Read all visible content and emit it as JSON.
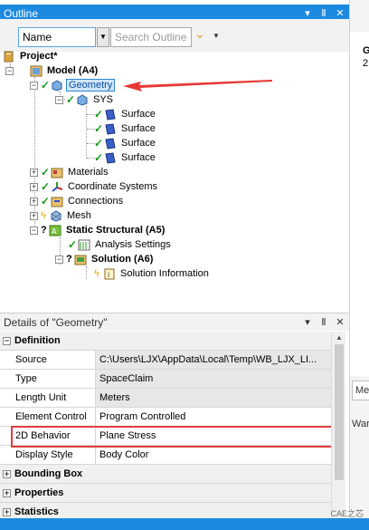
{
  "outline": {
    "title": "Outline",
    "controls": [
      "▾",
      "Ⅱ",
      "✕"
    ],
    "name_select": "Name",
    "search_placeholder": "Search Outline",
    "tree": {
      "project": "Project*",
      "model": "Model (A4)",
      "geometry": "Geometry",
      "sys": "SYS",
      "surfaces": [
        "Surface",
        "Surface",
        "Surface",
        "Surface"
      ],
      "materials": "Materials",
      "coordinate_systems": "Coordinate Systems",
      "connections": "Connections",
      "mesh": "Mesh",
      "static_structural": "Static Structural (A5)",
      "analysis_settings": "Analysis Settings",
      "solution": "Solution (A6)",
      "solution_information": "Solution Information"
    }
  },
  "details": {
    "title": "Details of \"Geometry\"",
    "controls": [
      "▾",
      "Ⅱ",
      "✕"
    ],
    "sections": {
      "definition": "Definition",
      "bounding_box": "Bounding Box",
      "properties": "Properties",
      "statistics": "Statistics"
    },
    "rows": [
      {
        "key": "Source",
        "value": "C:\\Users\\LJX\\AppData\\Local\\Temp\\WB_LJX_LI..."
      },
      {
        "key": "Type",
        "value": "SpaceClaim"
      },
      {
        "key": "Length Unit",
        "value": "Meters"
      },
      {
        "key": "Element Control",
        "value": "Program Controlled"
      },
      {
        "key": "2D Behavior",
        "value": "Plane Stress"
      },
      {
        "key": "Display Style",
        "value": "Body Color"
      }
    ]
  },
  "right_panel": {
    "letter_g": "G",
    "digit_2": "2",
    "tab_me": "Me",
    "war": "War"
  },
  "watermark": "CAE之芯",
  "colors": {
    "titlebar": "#1c8ae0",
    "highlight": "#e03c3c",
    "check": "#1a9a1a"
  }
}
